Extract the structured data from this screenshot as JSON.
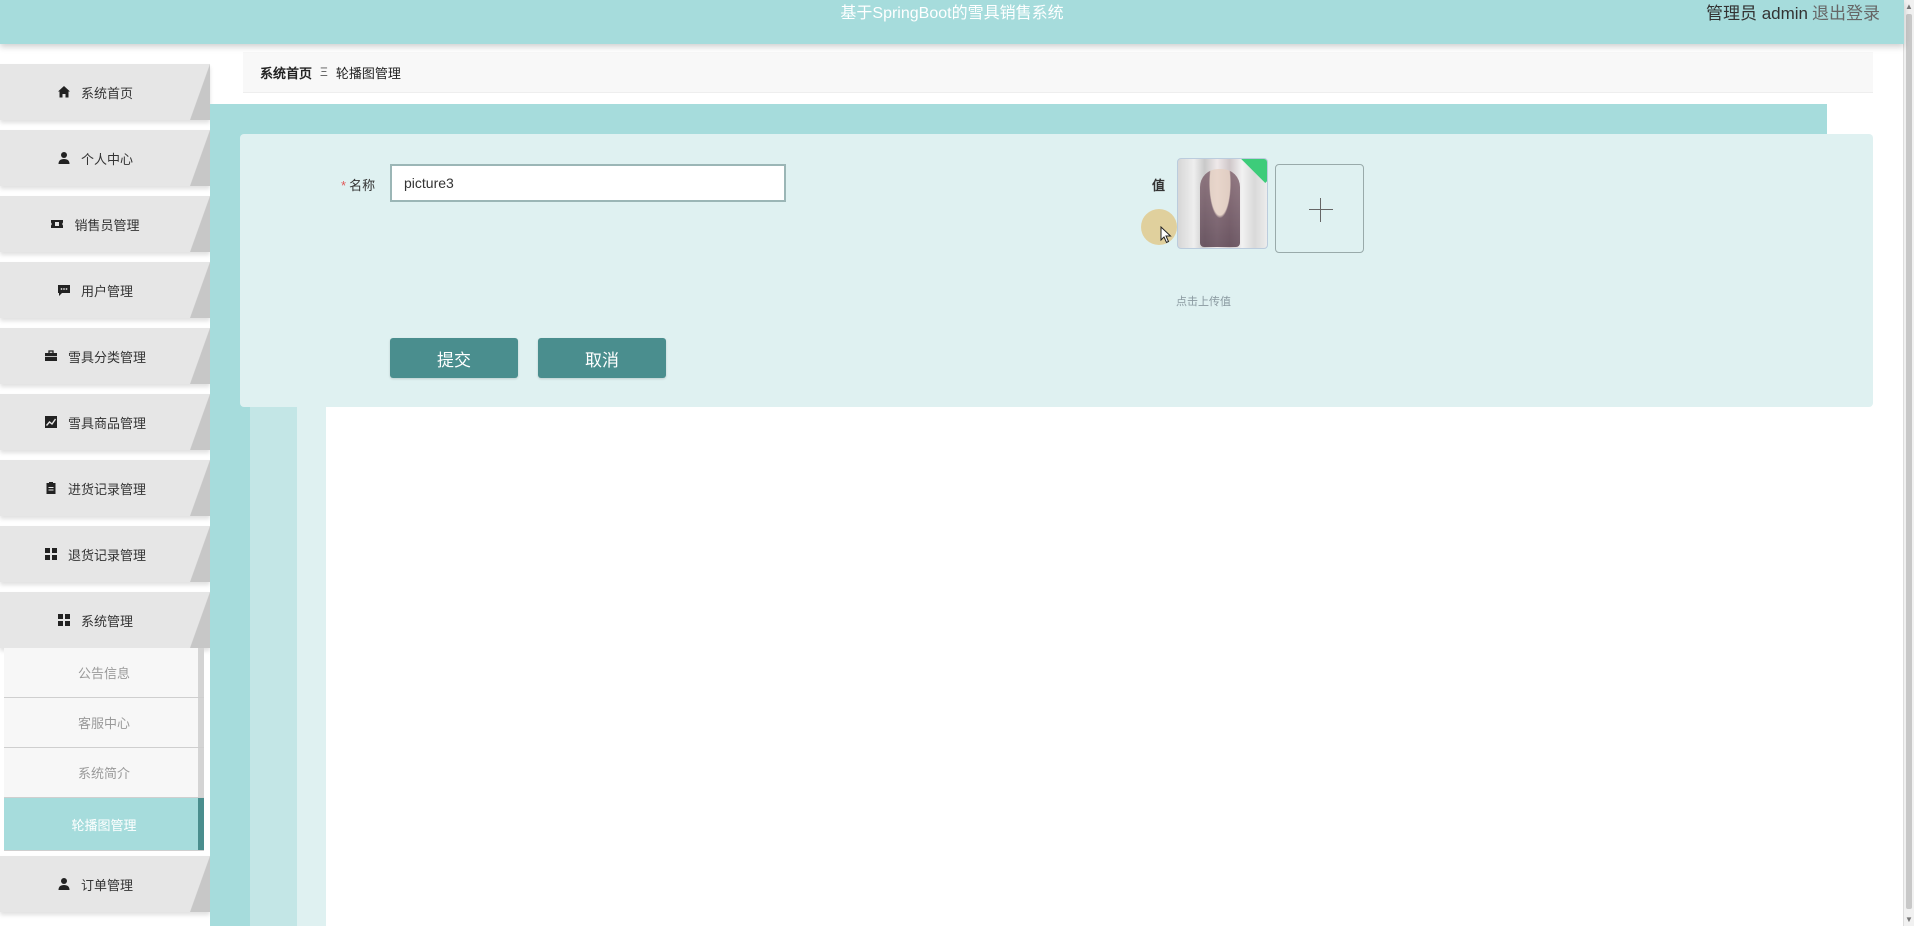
{
  "header": {
    "title": "基于SpringBoot的雪具销售系统",
    "user_text": "管理员 admin",
    "logout_label": "退出登录"
  },
  "sidebar": {
    "items": [
      {
        "label": "系统首页",
        "icon": "home-icon"
      },
      {
        "label": "个人中心",
        "icon": "user-icon"
      },
      {
        "label": "销售员管理",
        "icon": "ticket-icon"
      },
      {
        "label": "用户管理",
        "icon": "chat-icon"
      },
      {
        "label": "雪具分类管理",
        "icon": "briefcase-icon"
      },
      {
        "label": "雪具商品管理",
        "icon": "chart-icon"
      },
      {
        "label": "进货记录管理",
        "icon": "clipboard-icon"
      },
      {
        "label": "退货记录管理",
        "icon": "grid-icon"
      },
      {
        "label": "系统管理",
        "icon": "grid-icon"
      }
    ],
    "submenu": [
      {
        "label": "公告信息"
      },
      {
        "label": "客服中心"
      },
      {
        "label": "系统简介"
      },
      {
        "label": "轮播图管理",
        "active": true
      }
    ],
    "last_item": {
      "label": "订单管理",
      "icon": "user-icon"
    }
  },
  "breadcrumb": {
    "home": "系统首页",
    "separator": "Ξ",
    "current": "轮播图管理"
  },
  "form": {
    "name_label": "名称",
    "required_mark": "*",
    "name_value": "picture3",
    "value_label": "值",
    "upload_hint": "点击上传值",
    "submit_label": "提交",
    "cancel_label": "取消"
  },
  "colors": {
    "header_bg": "#a6dcdc",
    "accent": "#4a8e8e",
    "card_bg": "#dff1f1"
  }
}
